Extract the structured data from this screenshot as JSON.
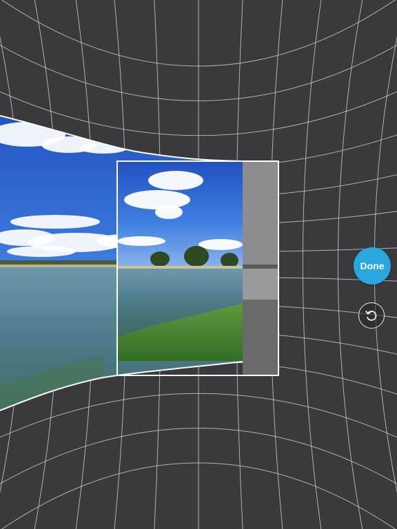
{
  "controls": {
    "done_label": "Done",
    "reset_icon": "rotate-ccw-icon",
    "done_color": "#2aa6df"
  },
  "scene": {
    "background_color": "#3a3a3c",
    "grid_color": "#e6e6e6",
    "frame_color": "#ffffff"
  }
}
